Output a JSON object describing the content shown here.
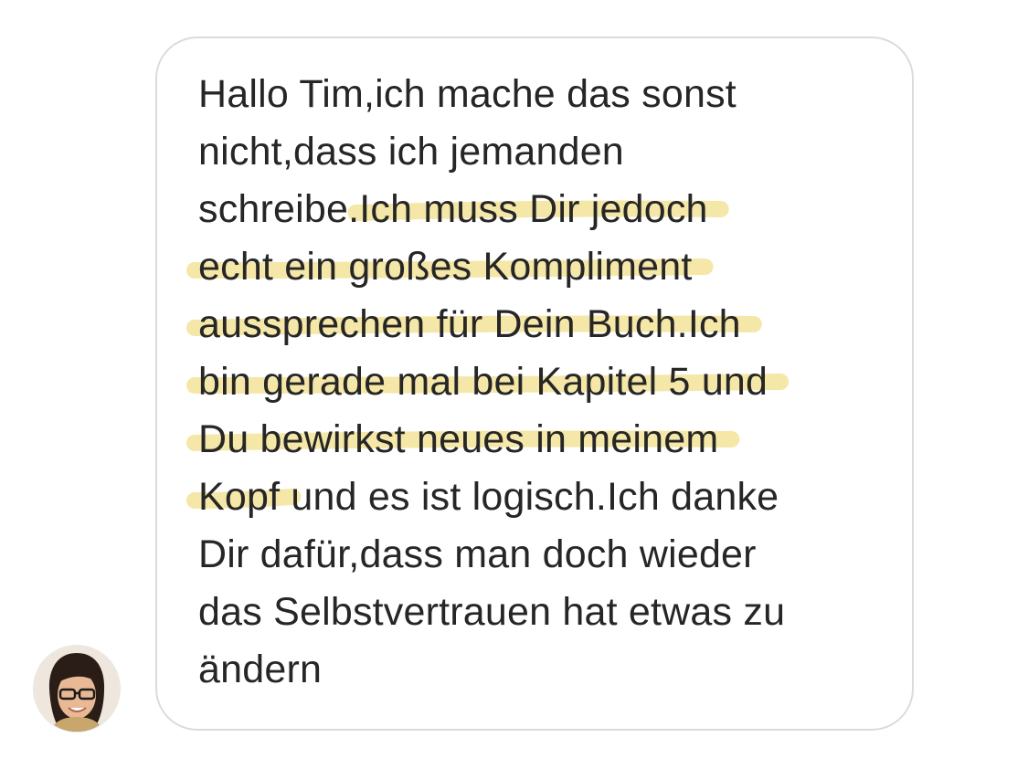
{
  "message": {
    "lines": [
      {
        "before": "Hallo Tim,ich mache das sonst",
        "highlight": "",
        "after": ""
      },
      {
        "before": "nicht,dass ich jemanden",
        "highlight": "",
        "after": ""
      },
      {
        "before": "schreibe.",
        "highlight": "Ich muss Dir jedoch",
        "after": ""
      },
      {
        "before": "",
        "highlight": "echt ein großes Kompliment",
        "after": ""
      },
      {
        "before": "",
        "highlight": "aussprechen für Dein Buch.Ich",
        "after": ""
      },
      {
        "before": "",
        "highlight": "bin gerade mal bei Kapitel 5 und",
        "after": ""
      },
      {
        "before": "",
        "highlight": "Du bewirkst neues in meinem",
        "after": ""
      },
      {
        "before": "",
        "highlight": "Kopf",
        "after": " und es ist logisch.Ich danke"
      },
      {
        "before": "Dir dafür,dass man doch wieder",
        "highlight": "",
        "after": ""
      },
      {
        "before": "das Selbstvertrauen hat etwas zu",
        "highlight": "",
        "after": ""
      },
      {
        "before": "ändern",
        "highlight": "",
        "after": ""
      }
    ]
  },
  "highlight_color": "#f5e6a3",
  "avatar": {
    "icon": "user-avatar-photo"
  }
}
